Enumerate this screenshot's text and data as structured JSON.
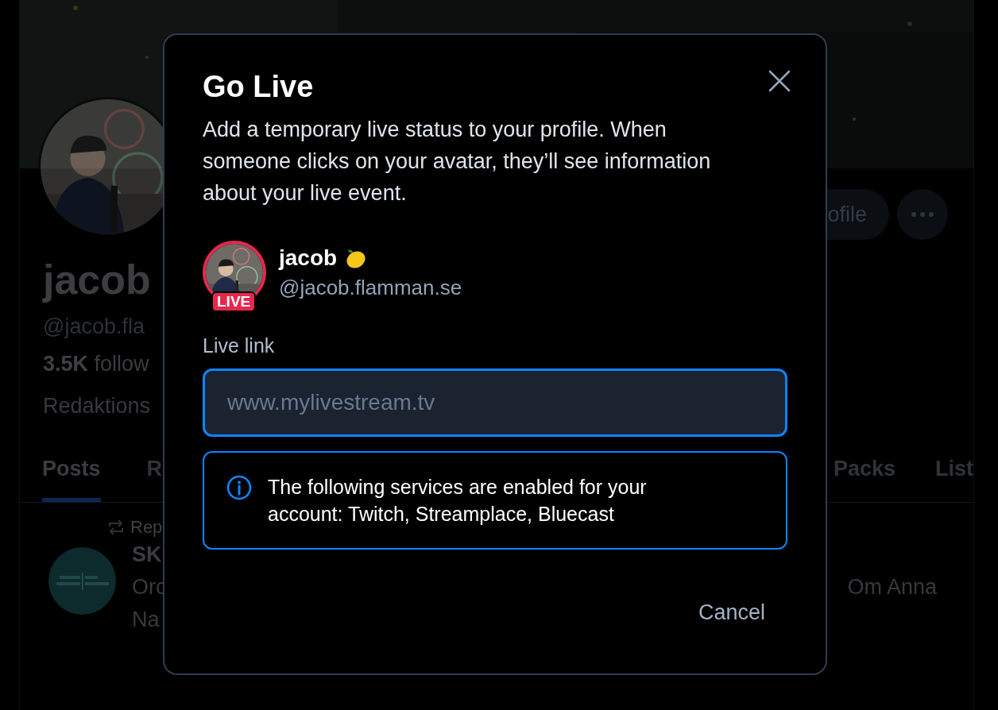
{
  "profile": {
    "name": "jacob",
    "handle": "@jacob.fla",
    "followers_count": "3.5K",
    "followers_label": "follow",
    "bio": "Redaktions",
    "edit_button": "ofile"
  },
  "tabs": [
    {
      "label": "Posts",
      "selected": true
    },
    {
      "label": "R",
      "selected": false
    },
    {
      "label": "Packs",
      "selected": false
    },
    {
      "label": "List",
      "selected": false
    }
  ],
  "post": {
    "repost_label": "Rep",
    "author": "SK",
    "lines": [
      "Orc",
      "Na"
    ],
    "line_end": "Om Anna"
  },
  "dialog": {
    "title": "Go Live",
    "description": "Add a temporary live status to your profile. When someone clicks on your avatar, they’ll see information about your live event.",
    "user": {
      "name": "jacob",
      "handle": "@jacob.flamman.se",
      "badge": "LIVE"
    },
    "live_link": {
      "label": "Live link",
      "placeholder": "www.mylivestream.tv",
      "focused": true
    },
    "notice": "The following services are enabled for your account: Twitch, Streamplace, Bluecast",
    "cancel_button": "Cancel"
  }
}
